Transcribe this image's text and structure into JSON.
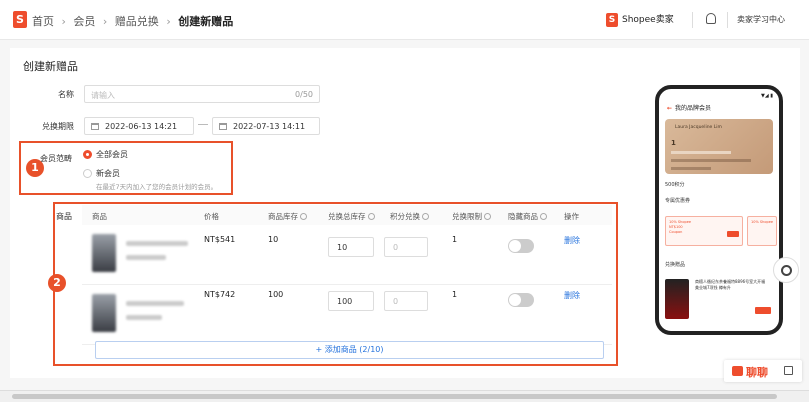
{
  "header": {
    "breadcrumbs": [
      "首页",
      "会员",
      "赠品兑换",
      "创建新赠品"
    ],
    "separator": "›",
    "logo_letter": "S",
    "seller_label": "Shopee卖家",
    "learning_center": "卖家学习中心"
  },
  "form": {
    "title": "创建新赠品",
    "name_label": "名称",
    "name_placeholder": "请输入",
    "name_counter": "0/50",
    "period_label": "兑换期限",
    "start_date": "2022-06-13 14:21",
    "end_date": "2022-07-13 14:11",
    "scope_label": "会员范畴",
    "scope_options": [
      {
        "label": "全部会员",
        "selected": true
      },
      {
        "label": "新会员",
        "selected": false
      }
    ],
    "scope_hint": "在最近7天内加入了您的会员计划的会员。",
    "products_label": "商品"
  },
  "annotations": {
    "badge1": "1",
    "badge2": "2"
  },
  "table": {
    "headers": [
      "商品",
      "价格",
      "商品库存",
      "兑换总库存",
      "积分兑换",
      "兑换限制",
      "隐藏商品",
      "操作"
    ],
    "rows": [
      {
        "price": "NT$541",
        "stock": "10",
        "total_stock": "10",
        "points_placeholder": "0",
        "limit": "1",
        "hidden": false,
        "action": "删除"
      },
      {
        "price": "NT$742",
        "stock": "100",
        "total_stock": "100",
        "points_placeholder": "0",
        "limit": "1",
        "hidden": false,
        "action": "删除"
      }
    ],
    "add_button": "+ 添加商品 (2/10)"
  },
  "preview": {
    "status": "▼◢ ▮",
    "title": "我的品牌会员",
    "member_name": "Laura Jacqueline Lim",
    "tier": "1",
    "points": "500积分",
    "section_coupons": "专属优惠券",
    "section_gifts": "兑换赠品",
    "gift_text": "商檀人循纪东茶養福特8896号室大开福美业城7项钱 樽有升"
  },
  "chat": {
    "label": "聊聊"
  },
  "colors": {
    "brand": "#ee4d2d",
    "annotation": "#e8512a",
    "link": "#2673dd"
  }
}
